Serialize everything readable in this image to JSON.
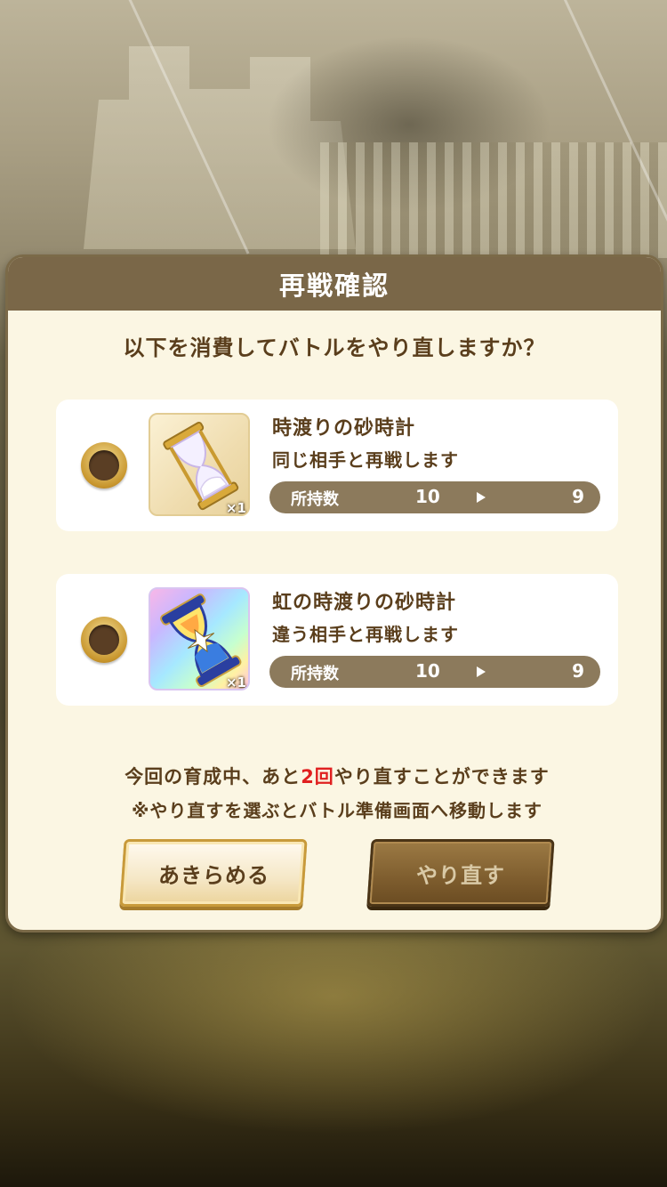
{
  "dialog": {
    "title": "再戦確認",
    "question": "以下を消費してバトルをやり直しますか？"
  },
  "options": [
    {
      "name": "時渡りの砂時計",
      "description": "同じ相手と再戦します",
      "cost_tag": "×1",
      "stock_label": "所持数",
      "stock_before": "10",
      "stock_after": "9",
      "icon": "hourglass-icon",
      "selected": false
    },
    {
      "name": "虹の時渡りの砂時計",
      "description": "違う相手と再戦します",
      "cost_tag": "×1",
      "stock_label": "所持数",
      "stock_before": "10",
      "stock_after": "9",
      "icon": "rainbow-hourglass-icon",
      "selected": false
    }
  ],
  "info": {
    "line1_prefix": "今回の育成中、あと",
    "line1_count": "2回",
    "line1_suffix": "やり直すことができます",
    "line2": "※やり直すを選ぶとバトル準備画面へ移動します"
  },
  "buttons": {
    "give_up": "あきらめる",
    "retry": "やり直す"
  },
  "colors": {
    "header": "#7a6748",
    "text": "#5a3e1c",
    "highlight": "#e02020",
    "stock_bar": "#8c7a5c"
  }
}
